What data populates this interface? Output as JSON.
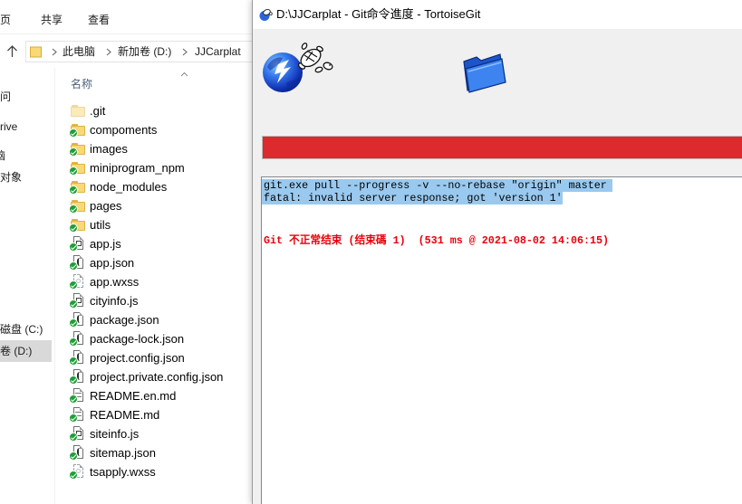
{
  "explorer": {
    "ribbon_tabs": [
      "页",
      "共享",
      "查看"
    ],
    "up_icon": "up-arrow-icon",
    "breadcrumb": [
      "此电脑",
      "新加卷 (D:)",
      "JJCarplat"
    ],
    "sidebar": [
      {
        "label": "问"
      },
      {
        "label": "rive"
      },
      {
        "label": "脑"
      },
      {
        "label": "对象"
      },
      {
        "label": "磁盘 (C:)"
      },
      {
        "label": "卷 (D:)",
        "selected": true
      }
    ],
    "column_header": "名称",
    "sort_icon": "sort-ascending-icon",
    "files": [
      {
        "name": ".git",
        "icon": "folder-icon",
        "hidden": true
      },
      {
        "name": "compoments",
        "icon": "folder-icon",
        "overlay": "check-overlay-icon"
      },
      {
        "name": "images",
        "icon": "folder-icon",
        "overlay": "check-overlay-icon"
      },
      {
        "name": "miniprogram_npm",
        "icon": "folder-icon",
        "overlay": "check-overlay-icon"
      },
      {
        "name": "node_modules",
        "icon": "folder-icon",
        "overlay": "check-overlay-icon"
      },
      {
        "name": "pages",
        "icon": "folder-icon",
        "overlay": "check-overlay-icon"
      },
      {
        "name": "utils",
        "icon": "folder-icon",
        "overlay": "check-overlay-icon"
      },
      {
        "name": "app.js",
        "icon": "js-file-icon",
        "overlay": "check-overlay-icon"
      },
      {
        "name": "app.json",
        "icon": "json-file-icon",
        "overlay": "check-overlay-icon"
      },
      {
        "name": "app.wxss",
        "icon": "wxss-file-icon",
        "overlay": "check-overlay-icon"
      },
      {
        "name": "cityinfo.js",
        "icon": "js-file-icon",
        "overlay": "check-overlay-icon"
      },
      {
        "name": "package.json",
        "icon": "json-file-icon",
        "overlay": "check-overlay-icon"
      },
      {
        "name": "package-lock.json",
        "icon": "json-file-icon",
        "overlay": "check-overlay-icon"
      },
      {
        "name": "project.config.json",
        "icon": "json-file-icon",
        "overlay": "check-overlay-icon"
      },
      {
        "name": "project.private.config.json",
        "icon": "json-file-icon",
        "overlay": "check-overlay-icon"
      },
      {
        "name": "README.en.md",
        "icon": "md-file-icon",
        "overlay": "check-overlay-icon"
      },
      {
        "name": "README.md",
        "icon": "md-file-icon",
        "overlay": "check-overlay-icon"
      },
      {
        "name": "siteinfo.js",
        "icon": "js-file-icon",
        "overlay": "check-overlay-icon"
      },
      {
        "name": "sitemap.json",
        "icon": "json-file-icon",
        "overlay": "check-overlay-icon"
      },
      {
        "name": "tsapply.wxss",
        "icon": "wxss-file-icon",
        "overlay": "check-overlay-icon"
      }
    ]
  },
  "dialog": {
    "title": "D:\\JJCarplat - Git命令進度 - TortoiseGit",
    "title_icon": "tortoisegit-icon",
    "animation_icons": [
      "globe-turtle-icon",
      "folder-icon"
    ],
    "progress": {
      "fraction": 1.0,
      "color": "#dc2a2f"
    },
    "log": {
      "selection_color": "#99c9ef",
      "lines": [
        {
          "text": "git.exe pull --progress -v --no-rebase \"origin\" master",
          "selected": true
        },
        {
          "text": "fatal: invalid server response; got 'version 1'",
          "selected": true
        },
        {
          "text": "Git 不正常结束 (结束碼 1)  (531 ms @ 2021-08-02 14:06:15)",
          "bold": true,
          "color": "#e8000b"
        }
      ]
    }
  },
  "colors": {
    "folder": "#f9d976",
    "check_overlay": "#1f9e37",
    "nav_selected": "#d9d9d9",
    "column_header": "#4c607a"
  }
}
